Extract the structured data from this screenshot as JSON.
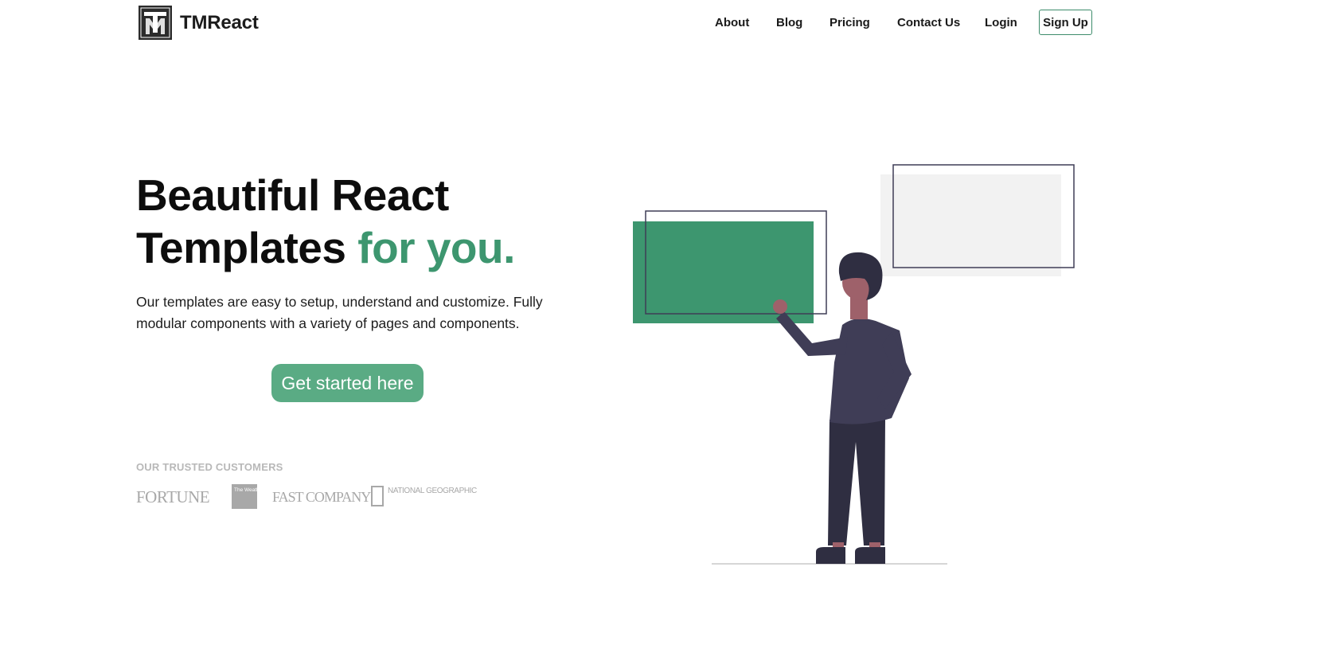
{
  "brand": {
    "name": "TMReact",
    "logo_icon": "tm-monogram-logo"
  },
  "nav": {
    "items": [
      "About",
      "Blog",
      "Pricing",
      "Contact Us",
      "Login"
    ],
    "signup_label": "Sign Up"
  },
  "hero": {
    "title_line1": "Beautiful React",
    "title_line2": "Templates",
    "title_accent": "for you.",
    "description": "Our templates are easy to setup, understand and customize. Fully modular components with a variety of pages and components.",
    "cta_label": "Get started here"
  },
  "trusted": {
    "label": "OUR TRUSTED CUSTOMERS",
    "logos": {
      "fortune": "FORTUNE",
      "weather": "The Weather Channel",
      "fastcompany": "FAST COMPANY",
      "natgeo": "NATIONAL GEOGRAPHIC"
    }
  },
  "colors": {
    "accent": "#3d966f",
    "button": "#5aab84",
    "dark": "#3f3d56",
    "muted": "#a8a8a8"
  },
  "illustration": {
    "icon": "person-presenting-illustration"
  }
}
